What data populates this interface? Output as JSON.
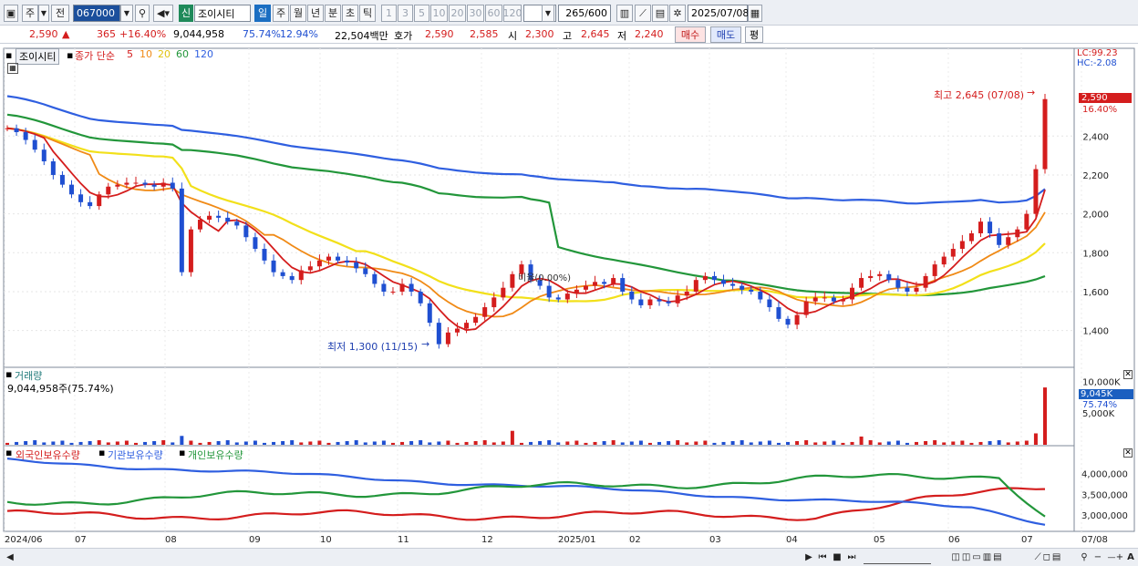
{
  "toolbar": {
    "market_label": "주",
    "prev_label": "전",
    "code": "067000",
    "new_badge": "신",
    "stock_name": "조이시티",
    "periods": [
      "일",
      "주",
      "월",
      "년",
      "분",
      "초",
      "틱"
    ],
    "active_period": "일",
    "intervals": [
      "1",
      "3",
      "5",
      "10",
      "20",
      "30",
      "60",
      "120"
    ],
    "count": "265",
    "count_total": "/600",
    "date": "2025/07/08"
  },
  "quote": {
    "price": "2,590",
    "change_arrow": "▲",
    "change": "365",
    "change_pct": "+16.40%",
    "volume": "9,044,958",
    "volume_ratio": "75.74%",
    "turnover": "12.94%",
    "amount": "22,504백만",
    "bid_label": "호가",
    "bid": "2,590",
    "ask": "2,585",
    "open_label": "시",
    "open": "2,300",
    "high_label": "고",
    "high": "2,645",
    "low_label": "저",
    "low": "2,240",
    "buy_label": "매수",
    "sell_label": "매도",
    "avg_label": "평"
  },
  "price_panel": {
    "name_tab": "조이시티",
    "ma_title": "종가 단순",
    "ma_periods": [
      "5",
      "10",
      "20",
      "60",
      "120"
    ],
    "ma_colors": [
      "#d41d1d",
      "#f08a16",
      "#f2e01a",
      "#22963a",
      "#2f5fe0"
    ],
    "lc": "LC:99.23",
    "hc": "HC:-2.08",
    "high_annot": "최고 2,645 (07/08)",
    "low_annot": "최저 1,300 (11/15)",
    "ratio_annot": "비율(0.00%)",
    "last_price_tag": "2,590",
    "last_pct_tag": "16.40%",
    "y_ticks": [
      "2,400",
      "2,200",
      "2,000",
      "1,800",
      "1,600",
      "1,400"
    ]
  },
  "volume_panel": {
    "title": "거래량",
    "value": "9,044,958주(75.74%)",
    "tag": "9,045K",
    "tag_pct": "75.74%",
    "y_ticks": [
      "10,000K",
      "5,000K"
    ]
  },
  "holder_panel": {
    "series": [
      "외국인보유수량",
      "기관보유수량",
      "개인보유수량"
    ],
    "colors": [
      "#d41d1d",
      "#2f5fe0",
      "#22963a"
    ],
    "y_ticks": [
      "4,000,000",
      "3,500,000",
      "3,000,000"
    ]
  },
  "x_axis": {
    "labels": [
      "2024/06",
      "07",
      "08",
      "09",
      "10",
      "11",
      "12",
      "2025/01",
      "02",
      "03",
      "04",
      "05",
      "06",
      "07",
      "07/08"
    ]
  },
  "chart_data": {
    "type": "candlestick",
    "price_range": [
      1300,
      2645
    ],
    "ylim": [
      1300,
      2650
    ],
    "close_series": [
      2440,
      2420,
      2380,
      2330,
      2270,
      2200,
      2150,
      2100,
      2060,
      2040,
      2100,
      2140,
      2150,
      2160,
      2160,
      2150,
      2140,
      2160,
      2130,
      1700,
      1920,
      1970,
      1990,
      1980,
      1960,
      1940,
      1880,
      1820,
      1760,
      1700,
      1680,
      1660,
      1710,
      1730,
      1760,
      1780,
      1760,
      1750,
      1720,
      1690,
      1640,
      1600,
      1600,
      1640,
      1600,
      1540,
      1440,
      1330,
      1390,
      1410,
      1440,
      1470,
      1520,
      1570,
      1620,
      1690,
      1740,
      1660,
      1630,
      1570,
      1560,
      1590,
      1610,
      1630,
      1650,
      1640,
      1670,
      1600,
      1560,
      1530,
      1560,
      1550,
      1540,
      1580,
      1600,
      1660,
      1680,
      1660,
      1640,
      1630,
      1610,
      1600,
      1560,
      1520,
      1460,
      1430,
      1480,
      1550,
      1570,
      1570,
      1550,
      1560,
      1620,
      1670,
      1680,
      1690,
      1660,
      1620,
      1600,
      1620,
      1680,
      1740,
      1780,
      1820,
      1860,
      1900,
      1960,
      1900,
      1840,
      1880,
      1920,
      2000,
      2230,
      2590
    ],
    "volume_high_k": 9045,
    "holders": {
      "foreign": {
        "start": 3000000,
        "end": 3800000
      },
      "institution": {
        "start": 4300000,
        "end": 2800000
      },
      "individual": {
        "start": 3300000,
        "end": 2800000
      }
    }
  },
  "statusbar": {
    "icons": [
      "nav-right-icon",
      "first-icon",
      "prev-icon",
      "stop-icon",
      "next-icon",
      "scroll-track-icon",
      "chart-type-icon",
      "zoom-icon",
      "minus-icon",
      "plus-icon",
      "font-icon"
    ]
  }
}
